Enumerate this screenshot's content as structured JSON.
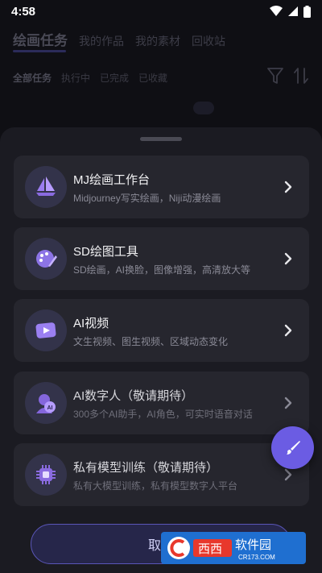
{
  "status_bar": {
    "time": "4:58"
  },
  "background": {
    "top_tabs": [
      "绘画任务",
      "我的作品",
      "我的素材",
      "回收站"
    ],
    "filters": [
      "全部任务",
      "执行中",
      "已完成",
      "已收藏"
    ]
  },
  "sheet": {
    "cards": [
      {
        "title": "MJ绘画工作台",
        "desc": "Midjourney写实绘画，Niji动漫绘画",
        "icon": "sailboat-icon"
      },
      {
        "title": "SD绘图工具",
        "desc": "SD绘画，AI换脸，图像增强，高清放大等",
        "icon": "palette-icon"
      },
      {
        "title": "AI视频",
        "desc": "文生视频、图生视频、区域动态变化",
        "icon": "video-icon"
      },
      {
        "title": "AI数字人（敬请期待）",
        "desc": "300多个AI助手，AI角色，可实时语音对话",
        "icon": "ai-avatar-icon"
      },
      {
        "title": "私有模型训练（敬请期待）",
        "desc": "私有大模型训练，私有模型数字人平台",
        "icon": "chip-icon"
      }
    ],
    "cancel_label": "取消"
  },
  "watermark": {
    "text": "西西软件园",
    "url": "CR173.COM"
  },
  "colors": {
    "accent": "#6b5ce3",
    "sheet_bg": "#1b1b22",
    "card_bg": "#26262e"
  }
}
